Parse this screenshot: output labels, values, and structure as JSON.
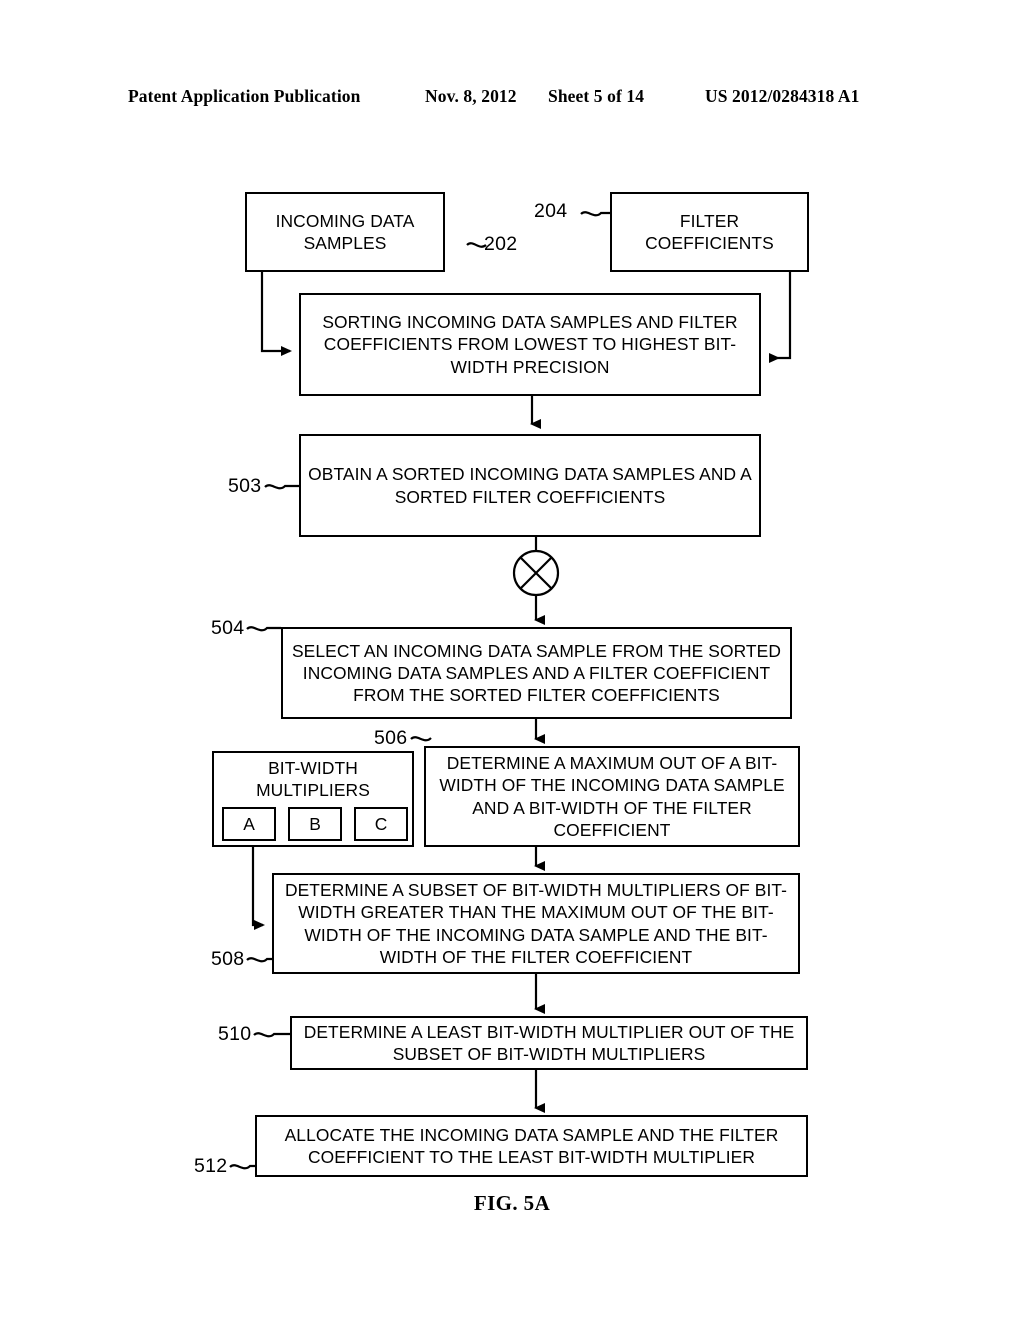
{
  "header": {
    "publication": "Patent Application Publication",
    "date": "Nov. 8, 2012",
    "sheet": "Sheet 5 of 14",
    "number": "US 2012/0284318 A1"
  },
  "figure": {
    "caption": "FIG. 5A",
    "boxes": {
      "incoming_data_samples": "INCOMING DATA SAMPLES",
      "filter_coefficients": "FILTER COEFFICIENTS",
      "sorting": "SORTING INCOMING DATA SAMPLES AND FILTER COEFFICIENTS FROM LOWEST TO HIGHEST BIT-WIDTH PRECISION",
      "obtain_sorted": "OBTAIN A SORTED INCOMING DATA SAMPLES AND A SORTED FILTER COEFFICIENTS",
      "select_sample": "SELECT AN INCOMING DATA SAMPLE FROM THE SORTED INCOMING DATA SAMPLES AND A FILTER COEFFICIENT FROM THE SORTED FILTER COEFFICIENTS",
      "determine_maximum": "DETERMINE A MAXIMUM OUT OF A BIT-WIDTH OF THE INCOMING DATA SAMPLE AND A BIT-WIDTH OF THE FILTER COEFFICIENT",
      "determine_subset": "DETERMINE A SUBSET OF BIT-WIDTH MULTIPLIERS OF BIT-WIDTH GREATER THAN THE MAXIMUM OUT OF THE BIT-WIDTH OF THE INCOMING DATA SAMPLE AND THE BIT-WIDTH OF THE FILTER COEFFICIENT",
      "determine_least": "DETERMINE A LEAST BIT-WIDTH MULTIPLIER OUT OF THE SUBSET OF BIT-WIDTH MULTIPLIERS",
      "allocate": "ALLOCATE THE INCOMING DATA SAMPLE AND THE FILTER COEFFICIENT TO THE LEAST BIT-WIDTH MULTIPLIER"
    },
    "multipliers": {
      "title": "BIT-WIDTH MULTIPLIERS",
      "cells": [
        "A",
        "B",
        "C"
      ]
    },
    "reference_numerals": {
      "incoming_data_samples": "202",
      "filter_coefficients": "204",
      "obtain_sorted": "503",
      "select_sample": "504",
      "determine_maximum": "506",
      "determine_subset": "508",
      "determine_least": "510",
      "allocate": "512"
    },
    "connector_symbol": "circled-x",
    "line_color": "#000000"
  }
}
